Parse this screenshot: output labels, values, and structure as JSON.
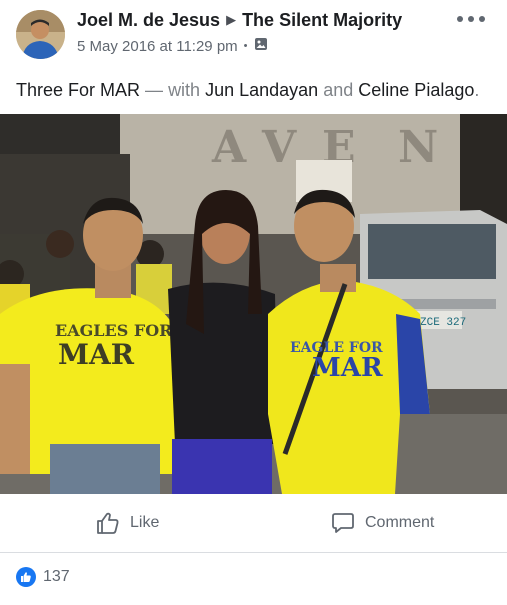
{
  "post": {
    "author": "Joel M. de Jesus",
    "group": "The Silent Majority",
    "timestamp": "5 May 2016 at 11:29 pm",
    "privacy_icon": "photo-album-icon",
    "caption": {
      "title": "Three For MAR",
      "separator": "—",
      "with_word": "with",
      "tagged_1": "Jun Landayan",
      "and_word": "and",
      "tagged_2": "Celine Pialago",
      "end": "."
    },
    "photo": {
      "shirt_text_line1": "EAGLES FOR",
      "shirt_text_line2": "MAR",
      "plate_text": "ZCE 327"
    }
  },
  "actions": {
    "like_label": "Like",
    "comment_label": "Comment"
  },
  "reactions": {
    "like_count": "137"
  },
  "colors": {
    "brand_blue": "#1877f2",
    "shirt_yellow": "#f3eb1d"
  }
}
